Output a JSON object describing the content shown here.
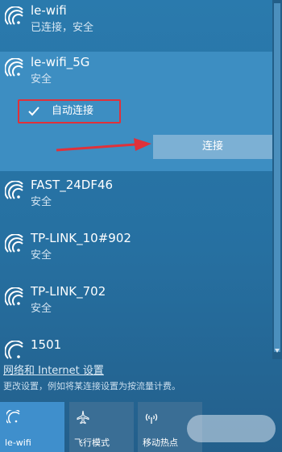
{
  "networks": [
    {
      "name": "le-wifi",
      "status": "已连接，安全"
    },
    {
      "name": "le-wifi_5G",
      "status": "安全"
    },
    {
      "name": "FAST_24DF46",
      "status": "安全"
    },
    {
      "name": "TP-LINK_10#902",
      "status": "安全"
    },
    {
      "name": "TP-LINK_702",
      "status": "安全"
    },
    {
      "name": "1501",
      "status": ""
    }
  ],
  "auto_connect": {
    "label": "自动连接",
    "checked": true
  },
  "connect_button": {
    "label": "连接"
  },
  "settings": {
    "link": "网络和 Internet 设置",
    "description": "更改设置，例如将某连接设置为按流量计费。"
  },
  "quick_actions": [
    {
      "label": "le-wifi",
      "icon": "wifi-icon",
      "active": true
    },
    {
      "label": "飞行模式",
      "icon": "airplane-icon",
      "active": false
    },
    {
      "label": "移动热点",
      "icon": "hotspot-icon",
      "active": false
    }
  ],
  "colors": {
    "panel": "#2670a1",
    "selected": "#3d8ec2",
    "highlight_box": "#e0313a",
    "arrow": "#e0313a",
    "active_tile": "#3f8fcc"
  }
}
